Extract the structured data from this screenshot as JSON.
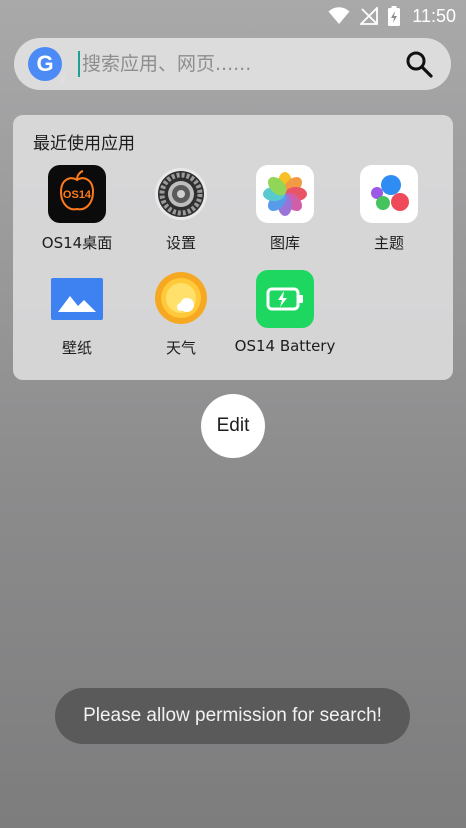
{
  "status_bar": {
    "time": "11:50",
    "icons": [
      "wifi-icon",
      "no-signal-icon",
      "battery-charging-icon"
    ]
  },
  "search": {
    "logo_letter": "G",
    "placeholder": "搜索应用、网页......",
    "search_icon": "search-icon"
  },
  "recent": {
    "title": "最近使用应用",
    "apps": [
      {
        "label": "OS14桌面",
        "icon": "os14-launcher-icon",
        "icon_text": "OS14"
      },
      {
        "label": "设置",
        "icon": "settings-gear-icon"
      },
      {
        "label": "图库",
        "icon": "photos-icon"
      },
      {
        "label": "主题",
        "icon": "theme-icon"
      },
      {
        "label": "壁纸",
        "icon": "wallpaper-icon"
      },
      {
        "label": "天气",
        "icon": "weather-sun-icon"
      },
      {
        "label": "OS14 Battery",
        "icon": "battery-app-icon"
      }
    ]
  },
  "edit_button": {
    "label": "Edit"
  },
  "toast": {
    "message": "Please allow permission for search!"
  },
  "colors": {
    "search_bg": "#dcdcdd",
    "google_blue": "#4c8bf5",
    "cursor": "#1fa196",
    "toast_bg": "#5a5a5b",
    "battery_green": "#1ed760"
  }
}
